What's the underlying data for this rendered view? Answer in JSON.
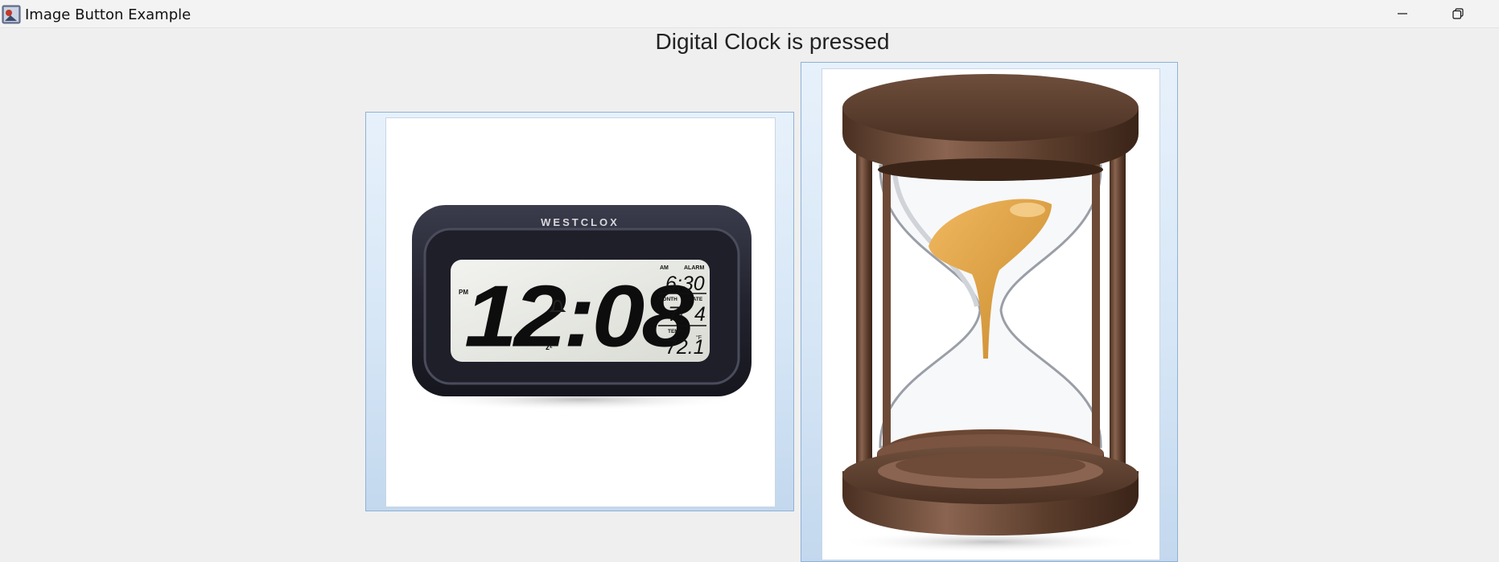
{
  "window": {
    "title": "Image Button Example",
    "icon": "java-app-icon",
    "controls": [
      "minimize-icon",
      "restore-icon"
    ]
  },
  "status": {
    "message": "Digital Clock is pressed"
  },
  "buttons": [
    {
      "name": "Digital Clock",
      "image": "digital-alarm-clock",
      "brand": "WESTCLOX",
      "time": "12:08",
      "meridiem": "PM",
      "am_label": "AM",
      "alarm_label": "ALARM",
      "alarm_time": "6:30",
      "month_label": "MONTH",
      "date_label": "DATE",
      "month": "7",
      "date": "4",
      "temp_label": "TEMP",
      "temp": "72.1",
      "temp_unit": "°F"
    },
    {
      "name": "Hourglass",
      "image": "hourglass"
    }
  ],
  "colors": {
    "window_bg": "#efefef",
    "button_border": "#8fb2d6",
    "clock_body": "#2c2d3a",
    "lcd": "#e8eae4",
    "hourglass_wood": "#5b3d2b",
    "sand": "#e0a24a"
  }
}
